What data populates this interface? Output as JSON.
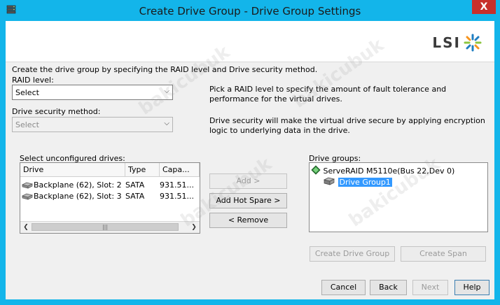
{
  "window": {
    "title": "Create Drive Group - Drive Group Settings",
    "close_label": "X"
  },
  "logo": {
    "text": "LSI"
  },
  "intro": "Create the drive group by specifying the RAID level and Drive security method.",
  "raid": {
    "label": "RAID level:",
    "value": "Select",
    "help": "Pick a RAID level to specify the amount of fault tolerance and performance for the virtual drives."
  },
  "security": {
    "label": "Drive security method:",
    "value": "Select",
    "help": "Drive security will make the virtual drive secure by applying encryption logic to underlying data in the drive."
  },
  "unconfigured": {
    "label": "Select unconfigured drives:",
    "columns": [
      "Drive",
      "Type",
      "Capa..."
    ],
    "rows": [
      {
        "drive": "Backplane (62), Slot: 2",
        "type": "SATA",
        "capacity": "931.51..."
      },
      {
        "drive": "Backplane (62), Slot: 3",
        "type": "SATA",
        "capacity": "931.51..."
      }
    ]
  },
  "middle_buttons": {
    "add": "Add >",
    "add_hot_spare": "Add Hot Spare >",
    "remove": "< Remove"
  },
  "drive_groups": {
    "label": "Drive groups:",
    "controller": "ServeRAID M5110e(Bus 22,Dev 0)",
    "group": "Drive Group1"
  },
  "group_buttons": {
    "create_drive_group": "Create Drive Group",
    "create_span": "Create Span"
  },
  "footer": {
    "cancel": "Cancel",
    "back": "Back",
    "next": "Next",
    "help": "Help"
  },
  "colors": {
    "title_bar": "#13b5ea",
    "close_button": "#c7302b",
    "selection": "#3399ff"
  },
  "watermark": "bakicubuk"
}
